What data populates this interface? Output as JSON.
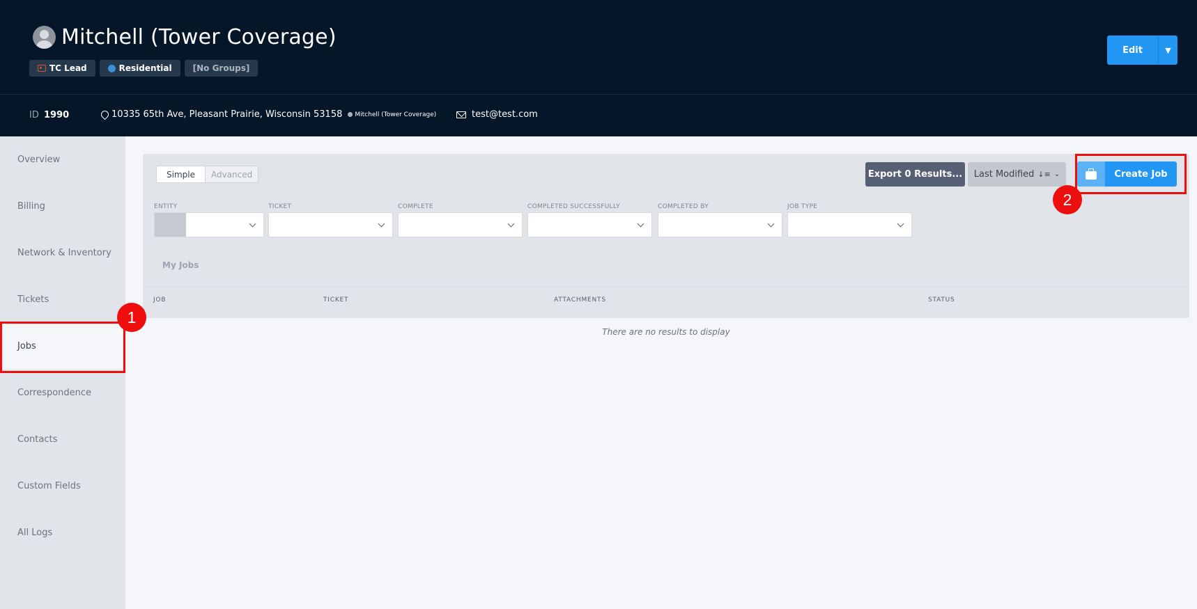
{
  "header": {
    "title": "Mitchell (Tower Coverage)",
    "tags": [
      {
        "label": "TC Lead",
        "icon": "tc-lead-icon"
      },
      {
        "label": "Residential",
        "icon": "residential-dot-icon"
      },
      {
        "label": "[No Groups]"
      }
    ],
    "edit_label": "Edit"
  },
  "info": {
    "id_label": "ID",
    "id_value": "1990",
    "address": "10335 65th Ave, Pleasant Prairie, Wisconsin 53158",
    "address_sub": "Mitchell (Tower Coverage)",
    "email": "test@test.com"
  },
  "sidebar": {
    "items": [
      {
        "label": "Overview"
      },
      {
        "label": "Billing"
      },
      {
        "label": "Network & Inventory"
      },
      {
        "label": "Tickets"
      },
      {
        "label": "Jobs",
        "active": true
      },
      {
        "label": "Correspondence"
      },
      {
        "label": "Contacts"
      },
      {
        "label": "Custom Fields"
      },
      {
        "label": "All Logs"
      }
    ]
  },
  "toolbar": {
    "mode_simple": "Simple",
    "mode_advanced": "Advanced",
    "export_label": "Export 0 Results...",
    "sort_label": "Last Modified",
    "create_label": "Create Job"
  },
  "filters": [
    {
      "label": "ENTITY"
    },
    {
      "label": "TICKET"
    },
    {
      "label": "COMPLETE"
    },
    {
      "label": "COMPLETED SUCCESSFULLY"
    },
    {
      "label": "COMPLETED BY"
    },
    {
      "label": "JOB TYPE"
    }
  ],
  "saved_view": "My Jobs",
  "table": {
    "columns": [
      "JOB",
      "TICKET",
      "ATTACHMENTS",
      "STATUS"
    ],
    "empty_text": "There are no results to display"
  },
  "annotations": [
    "1",
    "2"
  ],
  "colors": {
    "header_bg": "#041628",
    "primary": "#2196f3",
    "highlight": "#ee0e0e"
  }
}
